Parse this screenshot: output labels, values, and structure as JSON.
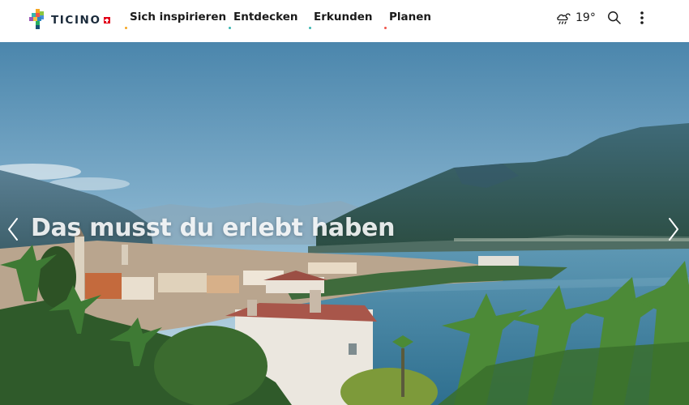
{
  "brand": {
    "name": "TICINO",
    "logo_icon": "ticino-logo-icon",
    "flag_icon": "swiss-flag-icon",
    "flag_color": "#e2001a"
  },
  "nav": {
    "items": [
      {
        "label": "Sich inspirieren",
        "dot_color": "#f5a623"
      },
      {
        "label": "Entdecken",
        "dot_color": "#38b6b0"
      },
      {
        "label": "Erkunden",
        "dot_color": "#38b6b0"
      },
      {
        "label": "Planen",
        "dot_color": "#f0564b"
      }
    ]
  },
  "weather": {
    "icon": "partly-cloudy-rain-icon",
    "temperature": "19°"
  },
  "actions": {
    "search_icon": "search-icon",
    "more_icon": "more-vertical-icon"
  },
  "hero": {
    "title": "Das musst du erlebt haben",
    "prev_icon": "chevron-left-icon",
    "next_icon": "chevron-right-icon"
  }
}
